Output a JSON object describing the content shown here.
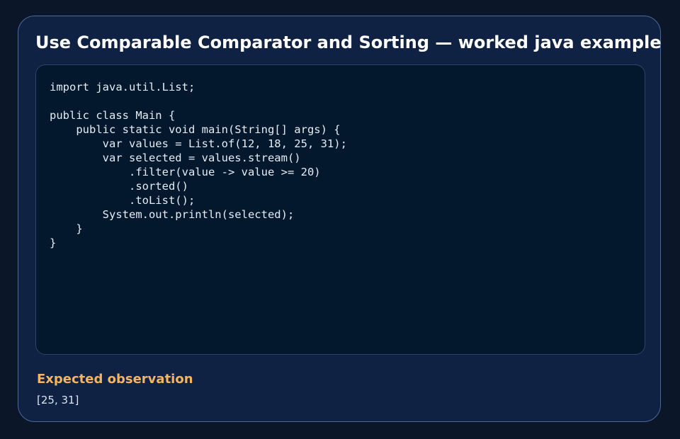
{
  "card": {
    "title": "Use Comparable Comparator and Sorting — worked java example"
  },
  "code": {
    "language": "java",
    "source": "import java.util.List;\n\npublic class Main {\n    public static void main(String[] args) {\n        var values = List.of(12, 18, 25, 31);\n        var selected = values.stream()\n            .filter(value -> value >= 20)\n            .sorted()\n            .toList();\n        System.out.println(selected);\n    }\n}"
  },
  "observation": {
    "heading": "Expected observation",
    "value": "[25, 31]"
  },
  "colors": {
    "page_background": "#0b1629",
    "card_background": "#0f2244",
    "card_border": "#4a6a9c",
    "code_background": "#03182d",
    "title_text": "#ffffff",
    "code_text": "#e6ecf5",
    "observation_heading": "#f5b461",
    "observation_text": "#dbe4f0"
  }
}
